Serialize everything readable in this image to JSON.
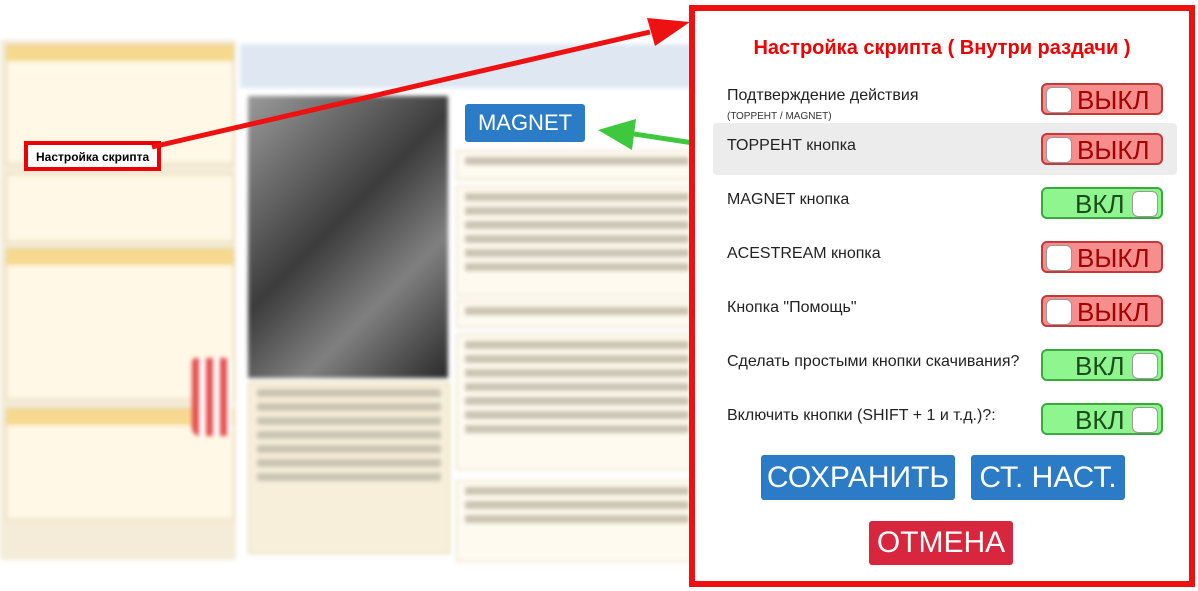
{
  "background_page": {
    "sidebar_link": "Настройка скрипта",
    "magnet_button": "MAGNET"
  },
  "modal": {
    "title": "Настройка скрипта ( Внутри раздачи )",
    "rows": [
      {
        "label": "Подтверждение действия",
        "sub": "(ТОРРЕНТ / MAGNET)",
        "state": "ВЫКЛ"
      },
      {
        "label": "ТОРРЕНТ кнопка",
        "state": "ВЫКЛ"
      },
      {
        "label": "MAGNET кнопка",
        "state": "ВКЛ"
      },
      {
        "label": "ACESTREAM кнопка",
        "state": "ВЫКЛ"
      },
      {
        "label": "Кнопка \"Помощь\"",
        "state": "ВЫКЛ"
      },
      {
        "label": "Сделать простыми кнопки скачивания?",
        "state": "ВКЛ"
      },
      {
        "label": "Включить кнопки (SHIFT + 1 и т.д.)?:",
        "state": "ВКЛ"
      }
    ],
    "buttons": {
      "save": "СОХРАНИТЬ",
      "reset": "СТ. НАСТ.",
      "cancel": "ОТМЕНА"
    }
  },
  "colors": {
    "accent_red": "#e11111",
    "button_blue": "#2b7bc6",
    "cancel_red": "#d7263d",
    "toggle_on": "#8ff58f",
    "toggle_off": "#f78e8e",
    "arrow_green": "#3ec83e"
  }
}
